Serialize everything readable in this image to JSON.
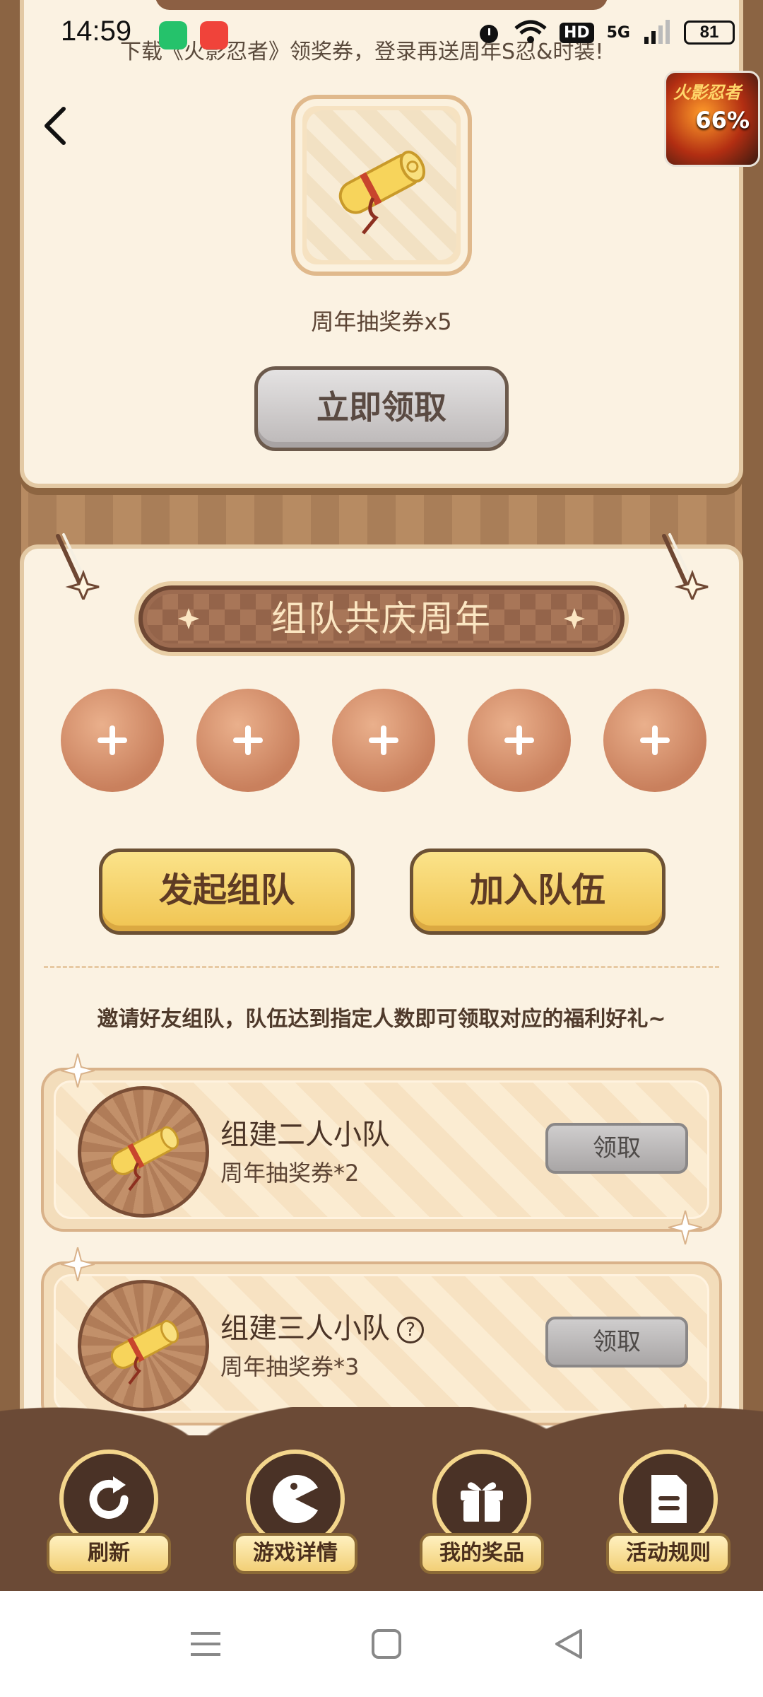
{
  "status_bar": {
    "time": "14:59",
    "network": "5G",
    "hd": "HD",
    "battery": "81"
  },
  "banner": {
    "text": "下载《火影忍者》领奖券，登录再送周年S忍&时装!"
  },
  "game_thumb": {
    "progress_text": "66%",
    "logo_text": "火影忍者"
  },
  "top_reward": {
    "label": "周年抽奖券x5",
    "button_label": "立即领取"
  },
  "team": {
    "title": "组队共庆周年",
    "slots": [
      "+",
      "+",
      "+",
      "+",
      "+"
    ],
    "start_team_label": "发起组队",
    "join_team_label": "加入队伍",
    "invite_text": "邀请好友组队，队伍达到指定人数即可领取对应的福利好礼~",
    "tasks": [
      {
        "title": "组建二人小队",
        "reward": "周年抽奖券*2",
        "button": "领取",
        "help": ""
      },
      {
        "title": "组建三人小队",
        "reward": "周年抽奖券*3",
        "button": "领取",
        "help": "?"
      }
    ]
  },
  "bottom_nav": [
    {
      "label": "刷新",
      "icon": "refresh-icon"
    },
    {
      "label": "游戏详情",
      "icon": "pacman-icon"
    },
    {
      "label": "我的奖品",
      "icon": "gift-icon"
    },
    {
      "label": "活动规则",
      "icon": "document-icon"
    }
  ],
  "colors": {
    "card_bg": "#fbf2e2",
    "wood": "#a97e58",
    "title_bar": "#9c6b50",
    "yellow_button": "#f0c451",
    "gray_button": "#bcb8b8",
    "nav_bg": "#6b4a36"
  }
}
